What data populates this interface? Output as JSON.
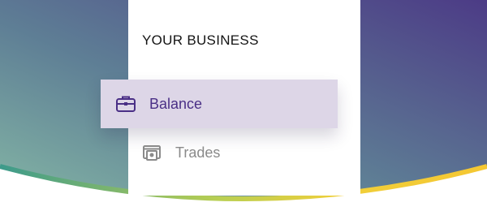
{
  "sidebar": {
    "section_title": "YOUR BUSINESS",
    "items": [
      {
        "label": "Balance",
        "icon": "briefcase-icon",
        "active": true
      },
      {
        "label": "Trades",
        "icon": "cash-icon",
        "active": false
      }
    ]
  },
  "colors": {
    "accent": "#4a2f86",
    "active_bg": "#ddd6e7",
    "inactive_text": "#8a8a8a",
    "gradient_left": "#7aa8a0",
    "gradient_right": "#4e3f86",
    "curve_left": "#3f9a8a",
    "curve_right": "#f2c835"
  }
}
